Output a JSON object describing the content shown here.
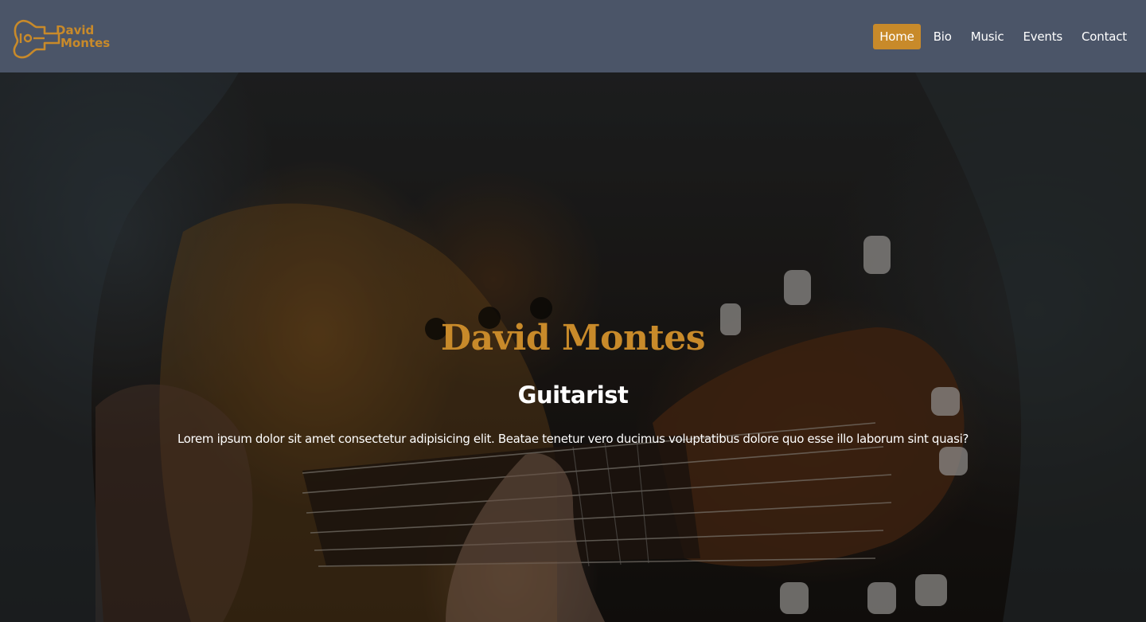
{
  "header": {
    "logo": {
      "line1": "David",
      "line2": "Montes",
      "icon": "guitar-icon"
    },
    "nav": [
      {
        "label": "Home",
        "active": true
      },
      {
        "label": "Bio",
        "active": false
      },
      {
        "label": "Music",
        "active": false
      },
      {
        "label": "Events",
        "active": false
      },
      {
        "label": "Contact",
        "active": false
      }
    ]
  },
  "hero": {
    "title": "David Montes",
    "subtitle": "Guitarist",
    "text": "Lorem ipsum dolor sit amet consectetur adipisicing elit. Beatae tenetur vero ducimus voluptatibus dolore quo esse illo laborum sint quasi?",
    "background": "guitar-player-photo"
  },
  "colors": {
    "accent": "#c88a2a",
    "navbar": "#4b5568",
    "text": "#ffffff"
  }
}
